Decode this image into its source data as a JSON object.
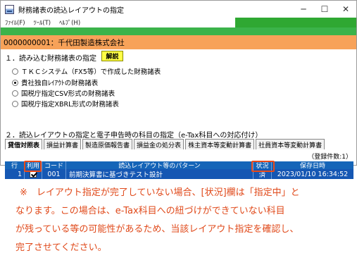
{
  "window": {
    "title": "財務諸表の読込レイアウトの指定",
    "minimize": "─",
    "maximize": "☐",
    "close": "✕"
  },
  "menu": {
    "file": "ﾌｧｲﾙ(F)",
    "tool": "ﾂｰﾙ(T)",
    "help": "ﾍﾙﾌﾟ(H)"
  },
  "company": {
    "label": "0000000001：千代田製造株式会社"
  },
  "section1": {
    "title": "１．読み込む財務諸表の指定",
    "help_label": "解説",
    "options": [
      "ＴＫＣシステム（FX5等）で作成した財務諸表",
      "貴社独自ﾚｲｱｳﾄの財務諸表",
      "国税庁指定CSV形式の財務諸表",
      "国税庁指定XBRL形式の財務諸表"
    ],
    "selected_index": 1
  },
  "section2": {
    "title": "２．読込レイアウトの指定と電子申告時の科目の指定（e-Tax科目への対応付け）"
  },
  "tabs": [
    "貸借対照表",
    "損益計算書",
    "製造原価報告書",
    "損益金の処分表",
    "株主資本等変動計算書",
    "社員資本等変動計算書"
  ],
  "registered_count": "（登録件数:1）",
  "table": {
    "headers": [
      "行",
      "利用",
      "コード",
      "読込レイアウト等のパターン",
      "状況",
      "保存日時"
    ],
    "rows": [
      {
        "row": "1",
        "use": true,
        "code": "001",
        "pattern": "前期決算書に基づきテスト設計",
        "status": "済",
        "saved": "2023/01/10 16:34:52"
      }
    ]
  },
  "note": {
    "lines": [
      "※　レイアウト指定が完了していない場合、[状況]欄は「指定中」と",
      "なります。この場合は、e-Tax科目への紐づけができていない科目",
      "が残っている等の可能性があるため、当該レイアウト指定を確認し、",
      "完了させてください。"
    ]
  },
  "colors": {
    "accent_green": "#3bb34a",
    "company_bar": "#f7a259",
    "table_blue": "#1557b3",
    "note_red": "#e0491a",
    "help_yellow": "#ffff46"
  }
}
